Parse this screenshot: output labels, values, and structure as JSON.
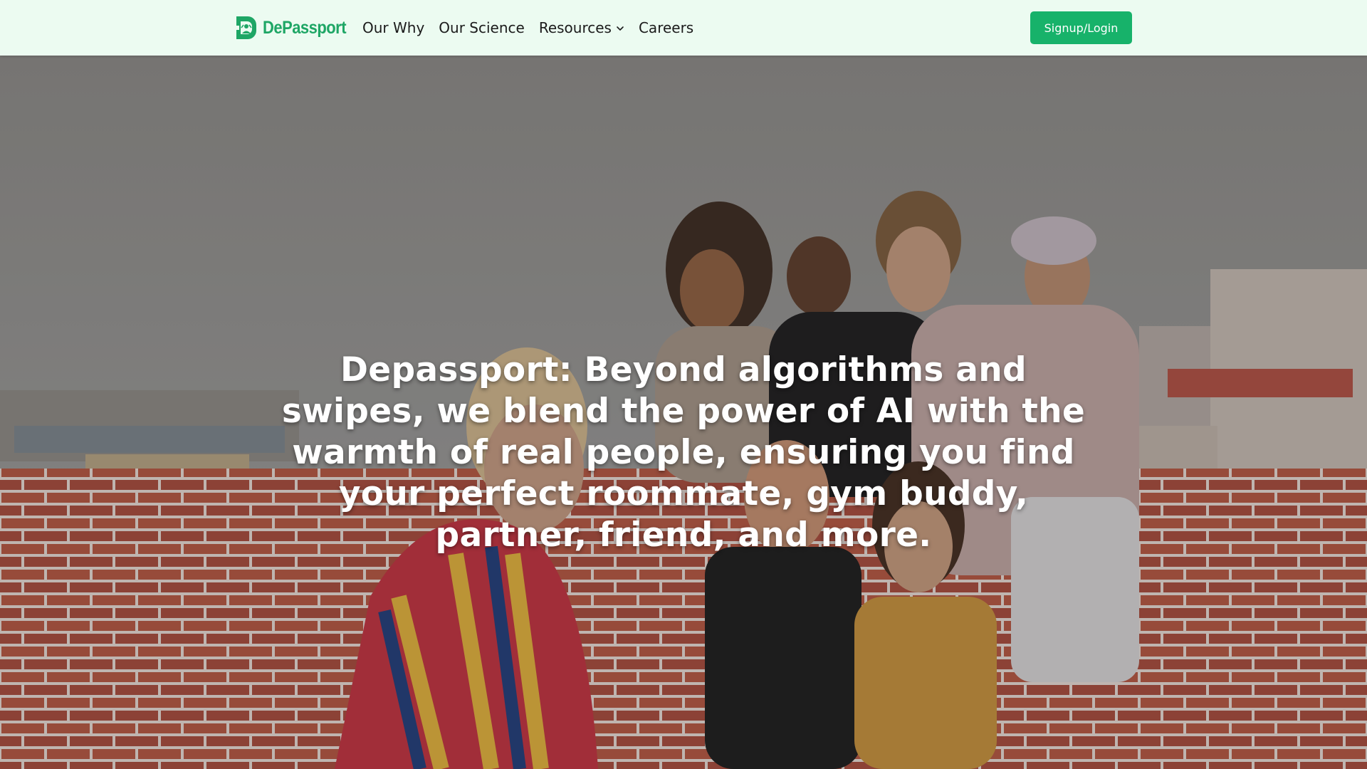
{
  "brand": {
    "name": "DePassport",
    "accent_color": "#17b26a",
    "logo_color": "#1ea665"
  },
  "nav": {
    "items": [
      {
        "label": "Our Why"
      },
      {
        "label": "Our Science"
      },
      {
        "label": "Resources",
        "has_dropdown": true,
        "icon": "chevron-down-icon"
      },
      {
        "label": "Careers"
      }
    ]
  },
  "header": {
    "background_color": "#ecfbf1",
    "cta_label": "Signup/Login"
  },
  "hero": {
    "heading": "Depassport: Beyond algorithms and swipes, we blend the power of AI with the warmth of real people, ensuring you find your perfect roommate, gym buddy, partner, friend, and more."
  }
}
